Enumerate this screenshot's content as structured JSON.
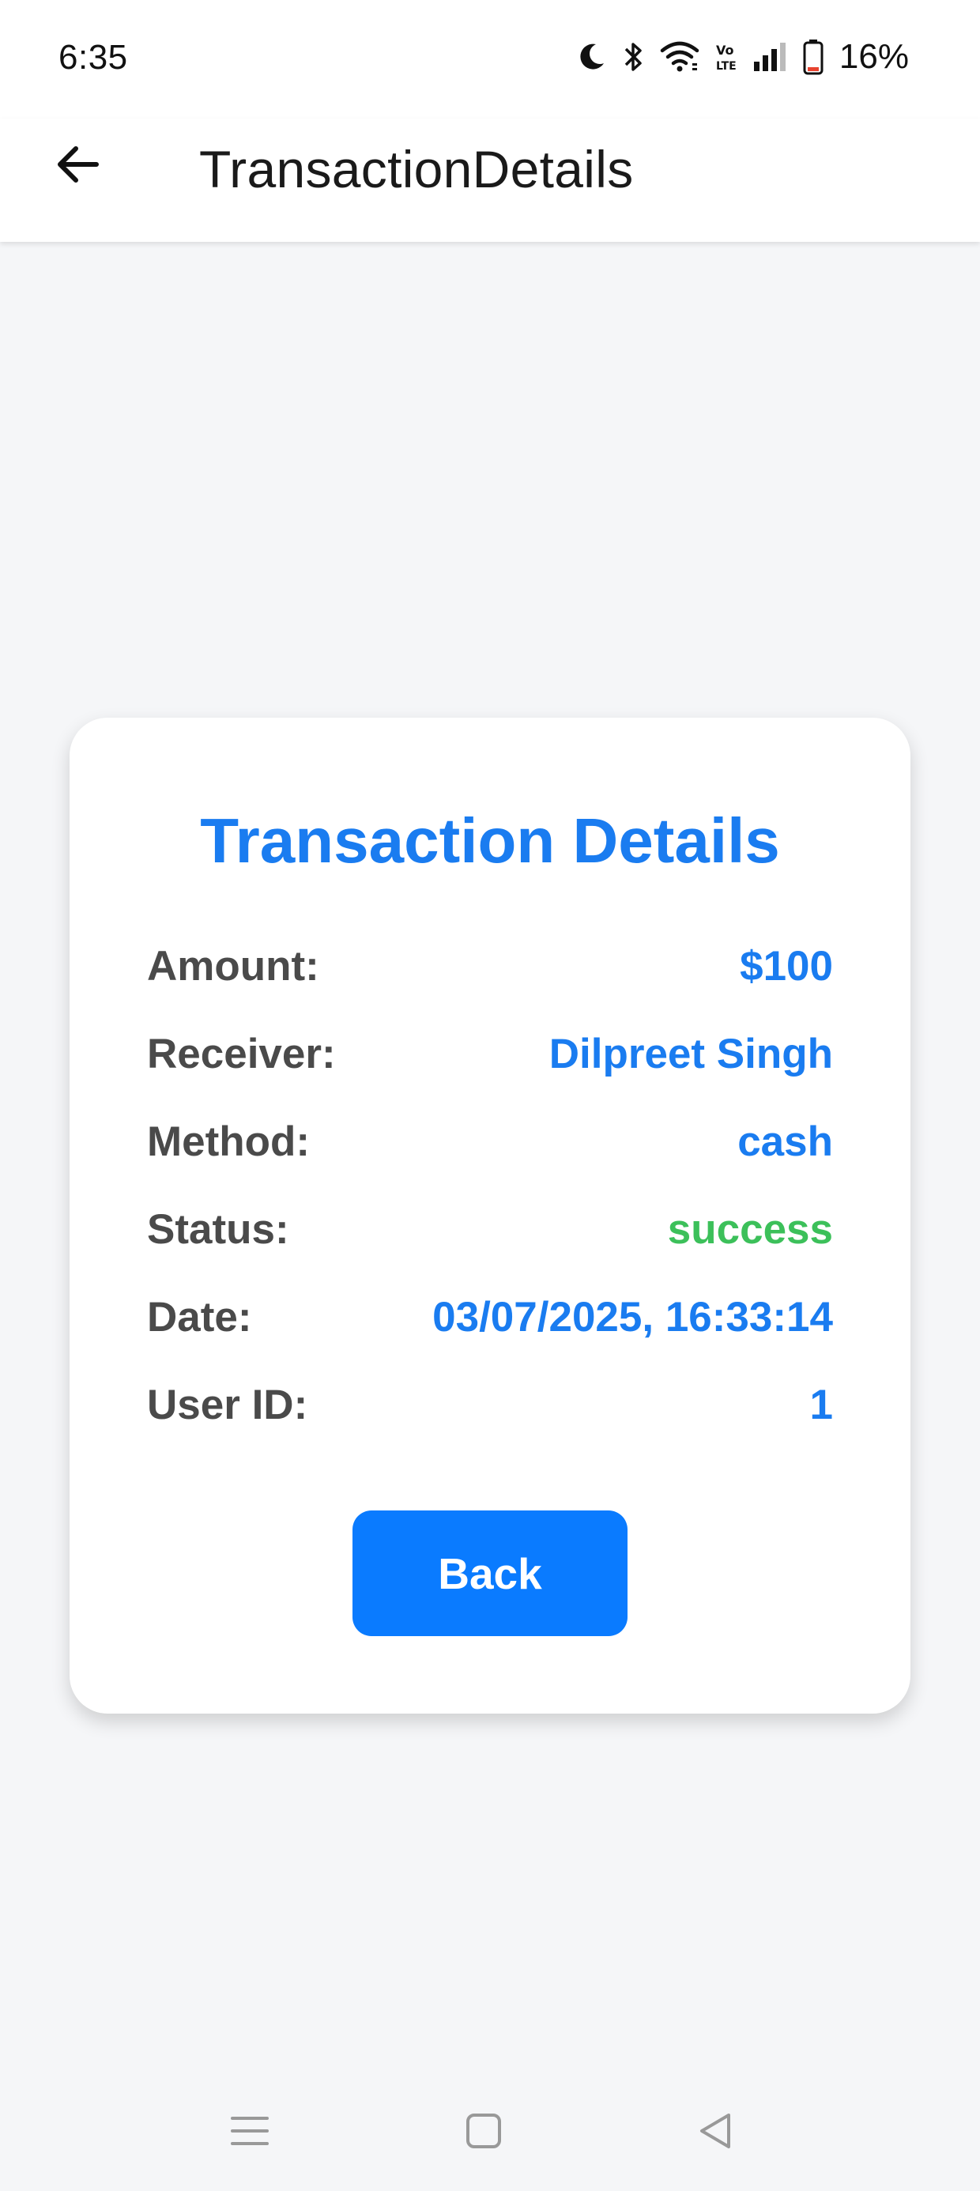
{
  "status_bar": {
    "time": "6:35",
    "battery_percent": "16%",
    "icons": [
      "moon-icon",
      "bluetooth-icon",
      "wifi-icon",
      "volte-icon",
      "signal-icon",
      "battery-icon"
    ]
  },
  "app_bar": {
    "title": "TransactionDetails",
    "back_icon": "arrow-left-icon"
  },
  "card": {
    "title": "Transaction Details",
    "rows": [
      {
        "label": "Amount:",
        "value": "$100"
      },
      {
        "label": "Receiver:",
        "value": "Dilpreet Singh"
      },
      {
        "label": "Method:",
        "value": "cash"
      },
      {
        "label": "Status:",
        "value": "success"
      },
      {
        "label": "Date:",
        "value": "03/07/2025, 16:33:14"
      },
      {
        "label": "User ID:",
        "value": "1"
      }
    ],
    "back_button_label": "Back"
  },
  "nav_bar": {
    "icons": [
      "menu-icon",
      "home-square-icon",
      "back-triangle-icon"
    ]
  },
  "colors": {
    "accent": "#1a7cf0",
    "button": "#0a7bff",
    "success": "#3cc05a",
    "label": "#4a4a4a",
    "background": "#f5f6f8"
  }
}
